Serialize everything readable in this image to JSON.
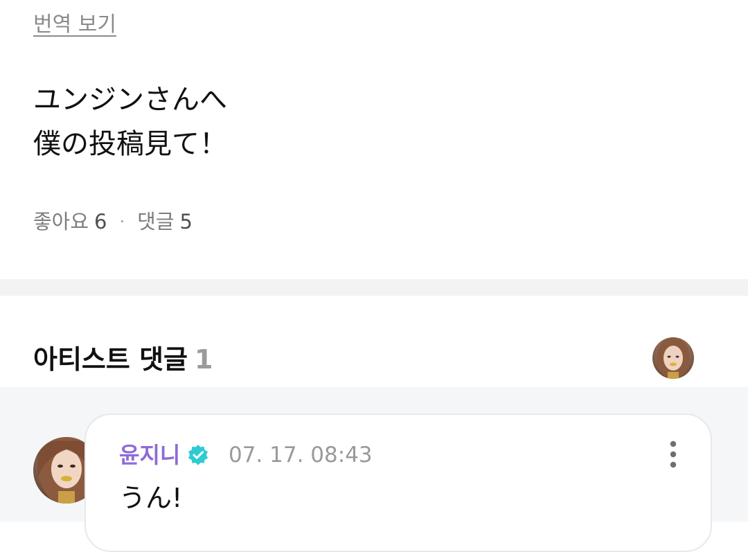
{
  "post": {
    "translate_label": "번역 보기",
    "body_lines": [
      "ユンジンさんへ",
      "僕の投稿見て！"
    ],
    "likes_label": "좋아요",
    "likes_count": "6",
    "separator": "·",
    "comments_label": "댓글",
    "comments_count": "5"
  },
  "artist_comments": {
    "title": "아티스트 댓글",
    "count": "1"
  },
  "comment": {
    "author": "윤지니",
    "timestamp": "07. 17. 08:43",
    "text": "うん!",
    "verified_icon": "verified-badge-icon",
    "menu_icon": "more-vertical-icon"
  },
  "colors": {
    "author_name": "#8f6ad8",
    "verified_badge": "#2ecbd3",
    "section_background": "#f5f6f8"
  }
}
